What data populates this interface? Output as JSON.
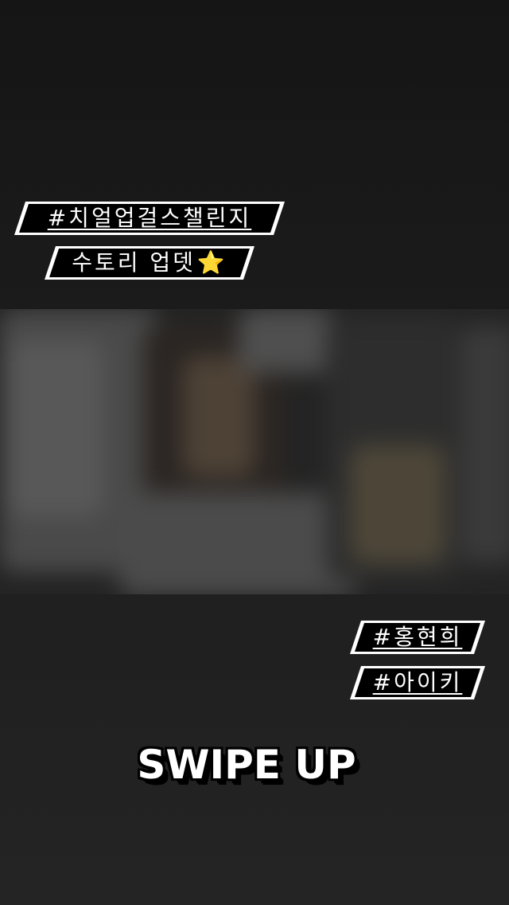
{
  "story": {
    "tags_top": [
      "#치얼업걸스챌린지",
      "수토리 업뎃"
    ],
    "tags_bottom": [
      "#홍현희",
      "#아이키"
    ],
    "star_emoji": "⭐",
    "cta_label": "SWIPE UP"
  },
  "colors": {
    "background": "#1c1c1c",
    "tag_text": "#ffffff",
    "tag_box": "#000000",
    "tag_border": "#ffffff",
    "star": "#f7c52a"
  },
  "icons": {
    "star": "star-emoji-icon"
  }
}
